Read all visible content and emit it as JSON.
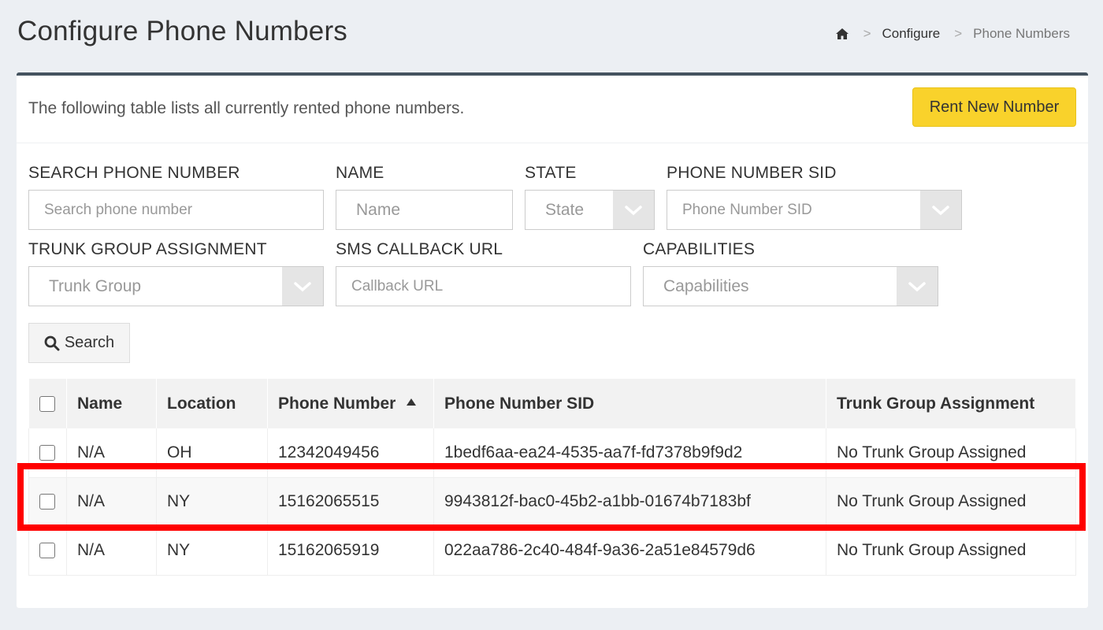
{
  "page": {
    "title": "Configure Phone Numbers",
    "breadcrumb": {
      "home_icon": "home-icon",
      "sep1": ">",
      "link": "Configure",
      "sep2": ">",
      "current": "Phone Numbers"
    }
  },
  "panel": {
    "description": "The following table lists all currently rented phone numbers.",
    "rent_button": "Rent New Number",
    "accent_color": "#f9d22b",
    "border_color": "#45535f"
  },
  "filters": {
    "search_label": "SEARCH PHONE NUMBER",
    "search_placeholder": "Search phone number",
    "name_label": "NAME",
    "name_placeholder": "Name",
    "state_label": "STATE",
    "state_value": "State",
    "sid_label": "PHONE NUMBER SID",
    "sid_value": "Phone Number SID",
    "trunk_label": "TRUNK GROUP ASSIGNMENT",
    "trunk_value": "Trunk Group",
    "sms_label": "SMS CALLBACK URL",
    "sms_placeholder": "Callback URL",
    "cap_label": "CAPABILITIES",
    "cap_value": "Capabilities",
    "search_button": "Search"
  },
  "table": {
    "headers": [
      "Name",
      "Location",
      "Phone Number",
      "Phone Number SID",
      "Trunk Group Assignment"
    ],
    "sorted_column": "Phone Number",
    "sort_direction": "ascending",
    "rows": [
      {
        "name": "N/A",
        "location": "OH",
        "phone": "12342049456",
        "sid": "1bedf6aa-ea24-4535-aa7f-fd7378b9f9d2",
        "trunk": "No Trunk Group Assigned"
      },
      {
        "name": "N/A",
        "location": "NY",
        "phone": "15162065515",
        "sid": "9943812f-bac0-45b2-a1bb-01674b7183bf",
        "trunk": "No Trunk Group Assigned"
      },
      {
        "name": "N/A",
        "location": "NY",
        "phone": "15162065919",
        "sid": "022aa786-2c40-484f-9a36-2a51e84579d6",
        "trunk": "No Trunk Group Assigned"
      }
    ]
  },
  "highlight": {
    "row_index": 1,
    "color": "#ff0000"
  }
}
